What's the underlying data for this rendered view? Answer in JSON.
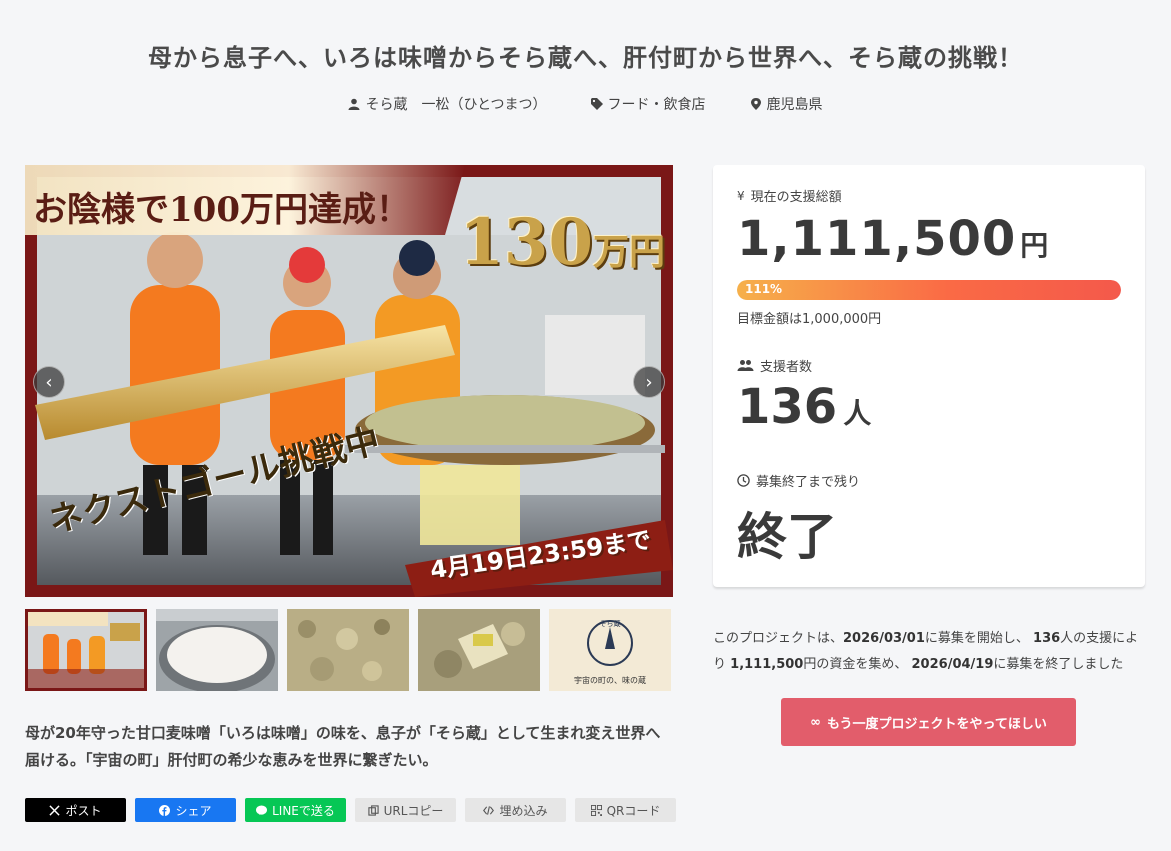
{
  "project": {
    "title": "母から息子へ、いろは味噌からそら蔵へ、肝付町から世界へ、そら蔵の挑戦！",
    "owner": "そら蔵　一松（ひとつまつ）",
    "category": "フード・飲食店",
    "location": "鹿児島県",
    "description": "母が20年守った甘口麦味噌「いろは味噌」の味を、息子が「そら蔵」として生まれ変え世界へ届ける。「宇宙の町」肝付町の希少な恵みを世界に繋ぎたい。"
  },
  "main_image": {
    "headline": "お陰様で100万円達成！",
    "amount_number": "130",
    "amount_unit": "万円",
    "challenge": "ネクストゴール挑戦中",
    "deadline": "4月19日23:59まで"
  },
  "gallery": {
    "prev_label": "‹",
    "next_label": "›",
    "thumb5_text_top": "そら蔵",
    "thumb5_text_bottom": "宇宙の町の、味の蔵"
  },
  "share": {
    "x": "ポスト",
    "facebook": "シェア",
    "line": "LINEで送る",
    "url_copy": "URLコピー",
    "embed": "埋め込み",
    "qr": "QRコード"
  },
  "stats": {
    "total_label": "現在の支援総額",
    "total_value": "1,111,500",
    "total_unit": "円",
    "progress_percent": 111,
    "progress_text": "111%",
    "goal_text": "目標金額は1,000,000円",
    "backers_label": "支援者数",
    "backers_value": "136",
    "backers_unit": "人",
    "remaining_label": "募集終了まで残り",
    "remaining_value": "終了"
  },
  "summary": {
    "part1": "このプロジェクトは、",
    "start_date": "2026/03/01",
    "part2": "に募集を開始し、",
    "backers": "136",
    "part3": "人の支援により",
    "amount": "1,111,500",
    "part4": "円の資金を集め、",
    "end_date": "2026/04/19",
    "part5": "に募集を終了しました"
  },
  "again_button": {
    "icon": "∞",
    "label": "もう一度プロジェクトをやってほしい"
  },
  "colors": {
    "accent": "#e25d6b",
    "progress_start": "#f6b04a",
    "progress_end": "#f4594b"
  }
}
